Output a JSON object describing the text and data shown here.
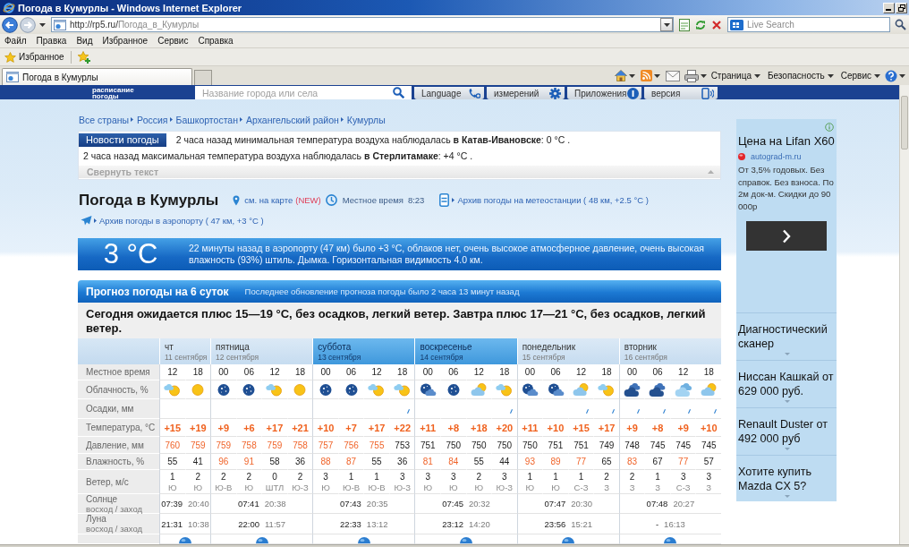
{
  "window": {
    "title": "Погода в Кумурлы - Windows Internet Explorer"
  },
  "address_bar": {
    "host": "http://rp5.ru/",
    "path": "Погода_в_Кумурлы"
  },
  "search": {
    "placeholder": "Live Search"
  },
  "menu": [
    "Файл",
    "Правка",
    "Вид",
    "Избранное",
    "Сервис",
    "Справка"
  ],
  "favorites_bar": {
    "label": "Избранное"
  },
  "tabs": [
    {
      "label": "Погода в Кумурлы",
      "selected": true
    }
  ],
  "command_bar": [
    "Страница",
    "Безопасность",
    "Сервис"
  ],
  "site_header": {
    "logo_text": "расписание погоды",
    "search_placeholder": "Название города или села",
    "buttons": [
      {
        "label": "Language",
        "kind": "language"
      },
      {
        "label": "измерений",
        "kind": "units"
      },
      {
        "label": "Приложения",
        "kind": "apps"
      },
      {
        "label": "версия",
        "kind": "mobile"
      }
    ]
  },
  "breadcrumbs": [
    "Все страны",
    "Россия",
    "Башкортостан",
    "Архангельский район",
    "Кумурлы"
  ],
  "news": {
    "label": "Новости погоды",
    "items": [
      "2 часа назад минимальная температура воздуха наблюдалась **в Катав-Ивановске**: 0 °C .",
      "2 часа назад максимальная температура воздуха наблюдалась **в Стерлитамаке**: +4 °C ."
    ],
    "collapse": "Свернуть текст"
  },
  "location": {
    "title": "Погода в Кумурлы",
    "map_link": "см. на карте",
    "map_badge": "(NEW)",
    "local_time_label": "Местное время",
    "local_time": "8:23",
    "station_archive": "Архив погоды на метеостанции ( 48 км, +2.5 °C )",
    "airport_archive": "Архив погоды в аэропорту ( 47 км, +3 °C )"
  },
  "current": {
    "temperature": "3 °C",
    "description": "22 минуты назад в аэропорту (47 км) было +3 °C, облаков нет, очень высокое атмосферное давление, очень высокая влажность (93%) штиль. Дымка. Горизонтальная видимость 4.0 км."
  },
  "forecast": {
    "title": "Прогноз погоды на 6 суток",
    "updated": "Последнее обновление прогноза погоды было 2 часа 13 минут назад",
    "summary": "Сегодня ожидается плюс 15—19 °C, без осадков, легкий ветер. Завтра плюс 17—21 °C, без осадков, легкий ветер.",
    "labels": {
      "time": "Местное время",
      "sky": "Облачность, %",
      "precip": "Осадки, мм",
      "temp": "Температура, °C",
      "pressure": "Давление, мм",
      "humidity": "Влажность, %",
      "wind": "Ветер, м/с",
      "sun": {
        "name": "Солнце",
        "detail": "восход / заход"
      },
      "moon": {
        "name": "Луна",
        "detail": "восход / заход"
      }
    },
    "days": [
      {
        "name": "чт",
        "date": "11 сентября",
        "weekend": false,
        "sunrise": "07:39",
        "sunset": "20:40",
        "moonrise": "21:31",
        "moonset": "10:38",
        "slots": [
          {
            "time": "12",
            "kind": "sun_cloud",
            "rain": false,
            "temp": "+15",
            "pressure": "760",
            "pressure_high": true,
            "humidity": "55",
            "humidity_high": false,
            "wind": "1",
            "wind_dir": "Ю"
          },
          {
            "time": "18",
            "kind": "sun",
            "rain": false,
            "temp": "+19",
            "pressure": "759",
            "pressure_high": true,
            "humidity": "41",
            "humidity_high": false,
            "wind": "2",
            "wind_dir": "Ю"
          }
        ]
      },
      {
        "name": "пятница",
        "date": "12 сентября",
        "weekend": false,
        "sunrise": "07:41",
        "sunset": "20:38",
        "moonrise": "22:00",
        "moonset": "11:57",
        "slots": [
          {
            "time": "00",
            "kind": "moon",
            "rain": false,
            "temp": "+9",
            "pressure": "759",
            "pressure_high": true,
            "humidity": "96",
            "humidity_high": true,
            "wind": "2",
            "wind_dir": "Ю-В"
          },
          {
            "time": "06",
            "kind": "moon",
            "rain": false,
            "temp": "+6",
            "pressure": "758",
            "pressure_high": true,
            "humidity": "91",
            "humidity_high": true,
            "wind": "2",
            "wind_dir": "Ю"
          },
          {
            "time": "12",
            "kind": "sun_cloud",
            "rain": false,
            "temp": "+17",
            "pressure": "759",
            "pressure_high": true,
            "humidity": "58",
            "humidity_high": false,
            "wind": "0",
            "wind_dir": "ШТЛ"
          },
          {
            "time": "18",
            "kind": "sun",
            "rain": false,
            "temp": "+21",
            "pressure": "758",
            "pressure_high": true,
            "humidity": "36",
            "humidity_high": false,
            "wind": "2",
            "wind_dir": "Ю-З"
          }
        ]
      },
      {
        "name": "суббота",
        "date": "13 сентября",
        "weekend": true,
        "sunrise": "07:43",
        "sunset": "20:35",
        "moonrise": "22:33",
        "moonset": "13:12",
        "slots": [
          {
            "time": "00",
            "kind": "moon",
            "rain": false,
            "temp": "+10",
            "pressure": "757",
            "pressure_high": true,
            "humidity": "88",
            "humidity_high": true,
            "wind": "3",
            "wind_dir": "Ю"
          },
          {
            "time": "06",
            "kind": "moon",
            "rain": false,
            "temp": "+7",
            "pressure": "756",
            "pressure_high": true,
            "humidity": "87",
            "humidity_high": true,
            "wind": "1",
            "wind_dir": "Ю-В"
          },
          {
            "time": "12",
            "kind": "sun_cloud",
            "rain": false,
            "temp": "+17",
            "pressure": "755",
            "pressure_high": true,
            "humidity": "55",
            "humidity_high": false,
            "wind": "1",
            "wind_dir": "Ю-В"
          },
          {
            "time": "18",
            "kind": "sun_cloud",
            "rain": true,
            "temp": "+22",
            "pressure": "753",
            "pressure_high": false,
            "humidity": "36",
            "humidity_high": false,
            "wind": "3",
            "wind_dir": "Ю-З"
          }
        ]
      },
      {
        "name": "воскресенье",
        "date": "14 сентября",
        "weekend": true,
        "sunrise": "07:45",
        "sunset": "20:32",
        "moonrise": "23:12",
        "moonset": "14:20",
        "slots": [
          {
            "time": "00",
            "kind": "moon_cloud",
            "rain": false,
            "temp": "+11",
            "pressure": "751",
            "pressure_high": false,
            "humidity": "81",
            "humidity_high": true,
            "wind": "3",
            "wind_dir": "Ю"
          },
          {
            "time": "06",
            "kind": "moon",
            "rain": false,
            "temp": "+8",
            "pressure": "750",
            "pressure_high": false,
            "humidity": "84",
            "humidity_high": true,
            "wind": "3",
            "wind_dir": "Ю"
          },
          {
            "time": "12",
            "kind": "cloud_sun",
            "rain": false,
            "temp": "+18",
            "pressure": "750",
            "pressure_high": false,
            "humidity": "55",
            "humidity_high": false,
            "wind": "2",
            "wind_dir": "Ю"
          },
          {
            "time": "18",
            "kind": "sun_cloud",
            "rain": true,
            "temp": "+20",
            "pressure": "750",
            "pressure_high": false,
            "humidity": "44",
            "humidity_high": false,
            "wind": "3",
            "wind_dir": "Ю-З"
          }
        ]
      },
      {
        "name": "понедельник",
        "date": "15 сентября",
        "weekend": false,
        "sunrise": "07:47",
        "sunset": "20:30",
        "moonrise": "23:56",
        "moonset": "15:21",
        "slots": [
          {
            "time": "00",
            "kind": "moon_cloud",
            "rain": false,
            "temp": "+11",
            "pressure": "750",
            "pressure_high": false,
            "humidity": "93",
            "humidity_high": true,
            "wind": "1",
            "wind_dir": "Ю"
          },
          {
            "time": "06",
            "kind": "moon_cloud",
            "rain": false,
            "temp": "+10",
            "pressure": "751",
            "pressure_high": false,
            "humidity": "89",
            "humidity_high": true,
            "wind": "1",
            "wind_dir": "Ю"
          },
          {
            "time": "12",
            "kind": "cloud_sun",
            "rain": true,
            "temp": "+15",
            "pressure": "751",
            "pressure_high": false,
            "humidity": "77",
            "humidity_high": true,
            "wind": "1",
            "wind_dir": "С-З"
          },
          {
            "time": "18",
            "kind": "sun_cloud",
            "rain": true,
            "temp": "+17",
            "pressure": "749",
            "pressure_high": false,
            "humidity": "65",
            "humidity_high": false,
            "wind": "2",
            "wind_dir": "З"
          }
        ]
      },
      {
        "name": "вторник",
        "date": "16 сентября",
        "weekend": false,
        "sunrise": "07:48",
        "sunset": "20:27",
        "moonrise": "-",
        "moonset": "16:13",
        "slots": [
          {
            "time": "00",
            "kind": "night_overcast",
            "rain": true,
            "temp": "+9",
            "pressure": "748",
            "pressure_high": false,
            "humidity": "83",
            "humidity_high": true,
            "wind": "2",
            "wind_dir": "З"
          },
          {
            "time": "06",
            "kind": "night_overcast",
            "rain": true,
            "temp": "+8",
            "pressure": "745",
            "pressure_high": false,
            "humidity": "67",
            "humidity_high": false,
            "wind": "1",
            "wind_dir": "З"
          },
          {
            "time": "12",
            "kind": "overcast",
            "rain": true,
            "temp": "+9",
            "pressure": "745",
            "pressure_high": false,
            "humidity": "77",
            "humidity_high": true,
            "wind": "3",
            "wind_dir": "С-З"
          },
          {
            "time": "18",
            "kind": "cloud_sun",
            "rain": true,
            "temp": "+10",
            "pressure": "745",
            "pressure_high": false,
            "humidity": "57",
            "humidity_high": false,
            "wind": "3",
            "wind_dir": "З"
          }
        ]
      }
    ]
  },
  "ad": {
    "title": "Цена на Lifan X60",
    "domain": "autograd-m.ru",
    "text": "От 3,5% годовых. Без справок. Без взноса. По 2м док-м. Скидки до 90 000р",
    "links": [
      "Диагностический сканер",
      "Ниссан Кашкай от 629 000 руб.",
      "Renault Duster от 492 000 руб",
      "Хотите купить Mazda CX 5?"
    ]
  }
}
